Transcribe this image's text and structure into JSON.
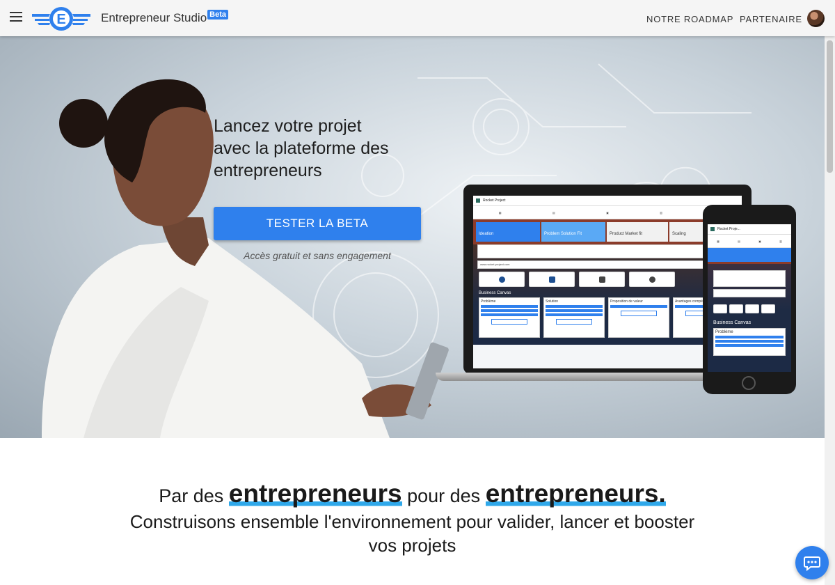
{
  "header": {
    "brand": "Entrepreneur Studio",
    "badge": "Beta",
    "nav": [
      "NOTRE ROADMAP",
      "PARTENAIRE"
    ]
  },
  "hero": {
    "headline_lines": [
      "Lancez votre projet",
      "avec la plateforme des",
      "entrepreneurs"
    ],
    "cta": "TESTER LA BETA",
    "cta_sub": "Accès gratuit et sans engagement"
  },
  "laptop": {
    "project_title": "Rocket Project",
    "stages": [
      "Ideation",
      "Problem Solution Fit",
      "Product Market fit",
      "Scaling"
    ],
    "site_value": "www.rocket-project.com",
    "canvas_title": "Business Canvas",
    "canvas_columns": [
      "Problème",
      "Solution",
      "Proposition de valeur",
      "Avantages compé"
    ]
  },
  "phone": {
    "project_title": "Rocket Proje...",
    "canvas_title": "Business Canvas",
    "card_title": "Problème"
  },
  "section": {
    "tag_prefix": "Par des",
    "tag_em1": "entrepreneurs",
    "tag_mid": "pour des",
    "tag_em2": "entrepreneurs.",
    "sub": "Construisons ensemble l'environnement pour valider, lancer et booster vos projets"
  },
  "colors": {
    "primary": "#2f80ed",
    "underline": "#2fa8ea"
  },
  "icons": [
    "menu-icon",
    "logo-icon",
    "chat-icon"
  ]
}
